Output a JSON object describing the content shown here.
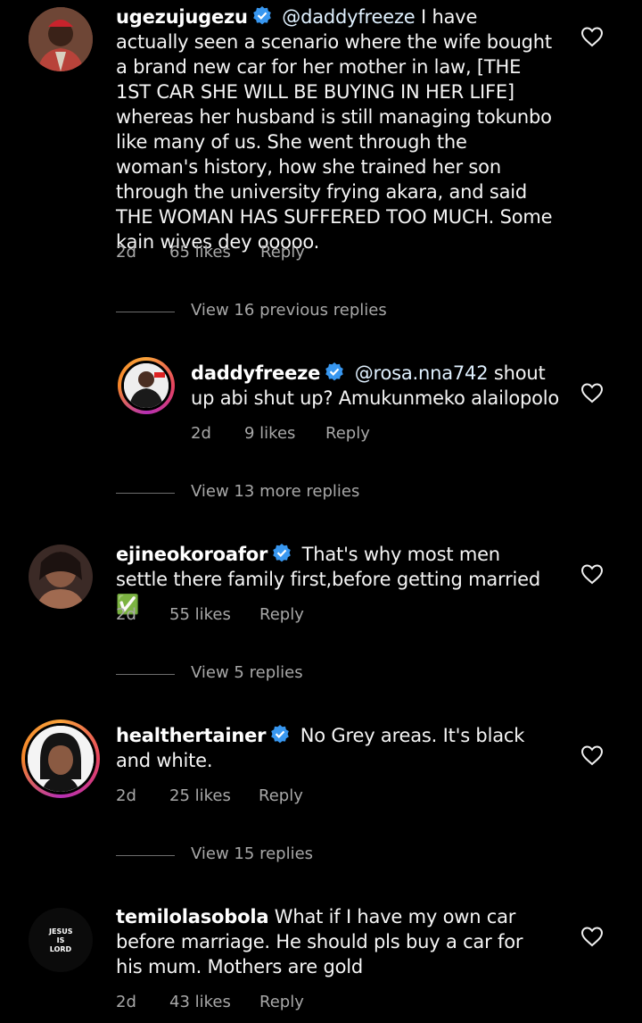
{
  "comments": [
    {
      "username": "ugezujugezu",
      "verified": true,
      "mention": "@daddyfreeze",
      "text": "I have actually seen a scenario where the wife bought a brand new car for her mother in law, [THE 1ST CAR SHE WILL BE BUYING IN HER LIFE] whereas her husband is still managing tokunbo like many of us. She went through the woman's history, how she trained her son through the university frying akara, and said THE WOMAN HAS SUFFERED TOO MUCH. Some kain wives dey ooooo.",
      "time": "2d",
      "likes": "65 likes",
      "reply": "Reply"
    },
    {
      "username": "daddyfreeze",
      "verified": true,
      "mention": "@rosa.nna742",
      "text": "shout up abi shut up? Amukunmeko alailopolo",
      "time": "2d",
      "likes": "9 likes",
      "reply": "Reply"
    },
    {
      "username": "ejineokoroafor",
      "verified": true,
      "mention": "",
      "text": "That's why most men settle there family first,before getting married ✅",
      "time": "2d",
      "likes": "55 likes",
      "reply": "Reply"
    },
    {
      "username": "healthertainer",
      "verified": true,
      "mention": "",
      "text": "No Grey areas. It's black and white.",
      "time": "2d",
      "likes": "25 likes",
      "reply": "Reply"
    },
    {
      "username": "temilolasobola",
      "verified": false,
      "mention": "",
      "text": "What if I have my own car before marriage. He should pls buy a car for his mum. Mothers are gold",
      "time": "2d",
      "likes": "43 likes",
      "reply": "Reply"
    }
  ],
  "view_rows": [
    "View 16 previous replies",
    "View 13 more replies",
    "View 5 replies",
    "View 15 replies"
  ],
  "avatar_text": {
    "temilolasobola": "JESUS IS LORD"
  },
  "icons": {
    "like": "heart-outline-icon",
    "verified": "verified-badge-icon"
  },
  "colors": {
    "background": "#000000",
    "text": "#f5f5f5",
    "muted": "#a8a8a8",
    "verified": "#3897f0"
  }
}
